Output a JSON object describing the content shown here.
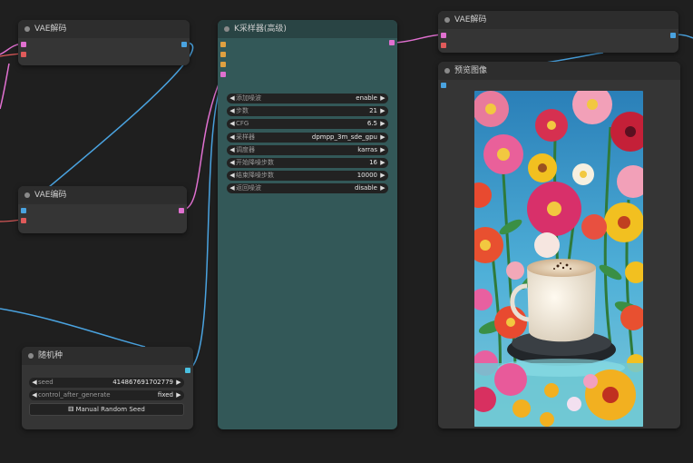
{
  "colors": {
    "canvas_bg": "#1f1f1f",
    "node_bg": "#353535",
    "ksampler_bg": "#335858",
    "latent_socket": "#e070d0",
    "vae_socket": "#e05a5a",
    "image_socket": "#4aa3e0"
  },
  "nodes": {
    "vae_decode_1": {
      "title": "VAE解码"
    },
    "vae_encode": {
      "title": "VAE编码"
    },
    "seed_node": {
      "title": "随机种",
      "widgets": [
        {
          "label": "seed",
          "value": "414867691702779"
        },
        {
          "label": "control_after_generate",
          "value": "fixed"
        }
      ],
      "button_label": "Manual Random Seed",
      "button_icon": "dice-icon"
    },
    "ksampler": {
      "title": "K采样器(高级)",
      "widgets": [
        {
          "label": "添加噪波",
          "value": "enable"
        },
        {
          "label": "步数",
          "value": "21"
        },
        {
          "label": "CFG",
          "value": "6.5"
        },
        {
          "label": "采样器",
          "value": "dpmpp_3m_sde_gpu"
        },
        {
          "label": "调度器",
          "value": "karras"
        },
        {
          "label": "开始降噪步数",
          "value": "16"
        },
        {
          "label": "结束降噪步数",
          "value": "10000"
        },
        {
          "label": "返回噪波",
          "value": "disable"
        }
      ]
    },
    "vae_decode_2": {
      "title": "VAE解码"
    },
    "preview_image": {
      "title": "预览图像",
      "image_description": "coffee-cup-with-flowers"
    }
  }
}
